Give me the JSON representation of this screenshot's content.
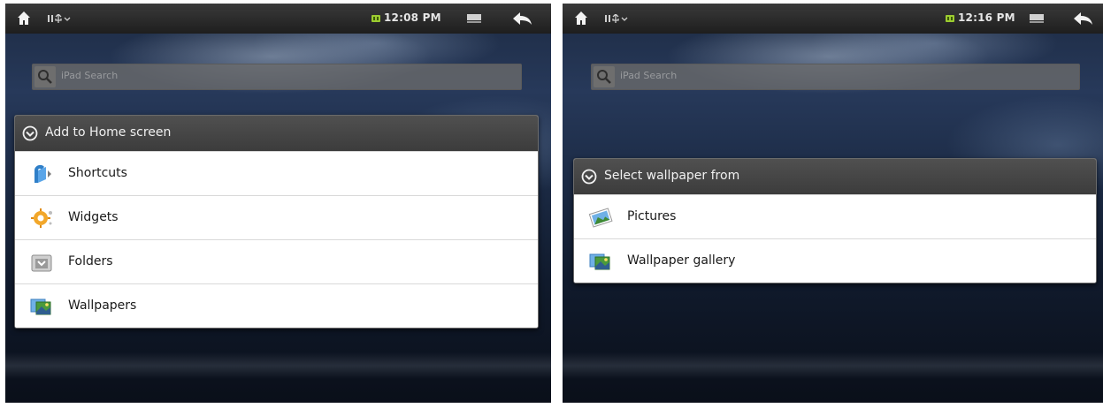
{
  "screens": [
    {
      "status_bar": {
        "time": "12:08 PM"
      },
      "search": {
        "placeholder": "iPad Search"
      },
      "dialog": {
        "title": "Add to Home screen",
        "items": [
          {
            "label": "Shortcuts",
            "icon": "shortcuts-icon"
          },
          {
            "label": "Widgets",
            "icon": "widgets-icon"
          },
          {
            "label": "Folders",
            "icon": "folders-icon"
          },
          {
            "label": "Wallpapers",
            "icon": "wallpapers-icon"
          }
        ]
      }
    },
    {
      "status_bar": {
        "time": "12:16 PM"
      },
      "search": {
        "placeholder": "iPad Search"
      },
      "dialog": {
        "title": "Select wallpaper from",
        "items": [
          {
            "label": "Pictures",
            "icon": "pictures-icon"
          },
          {
            "label": "Wallpaper gallery",
            "icon": "wallpaper-gallery-icon"
          }
        ]
      }
    }
  ],
  "colors": {
    "status_bar": "#2a2a2a",
    "dialog_header": "#444444",
    "battery": "#9ccc30"
  }
}
